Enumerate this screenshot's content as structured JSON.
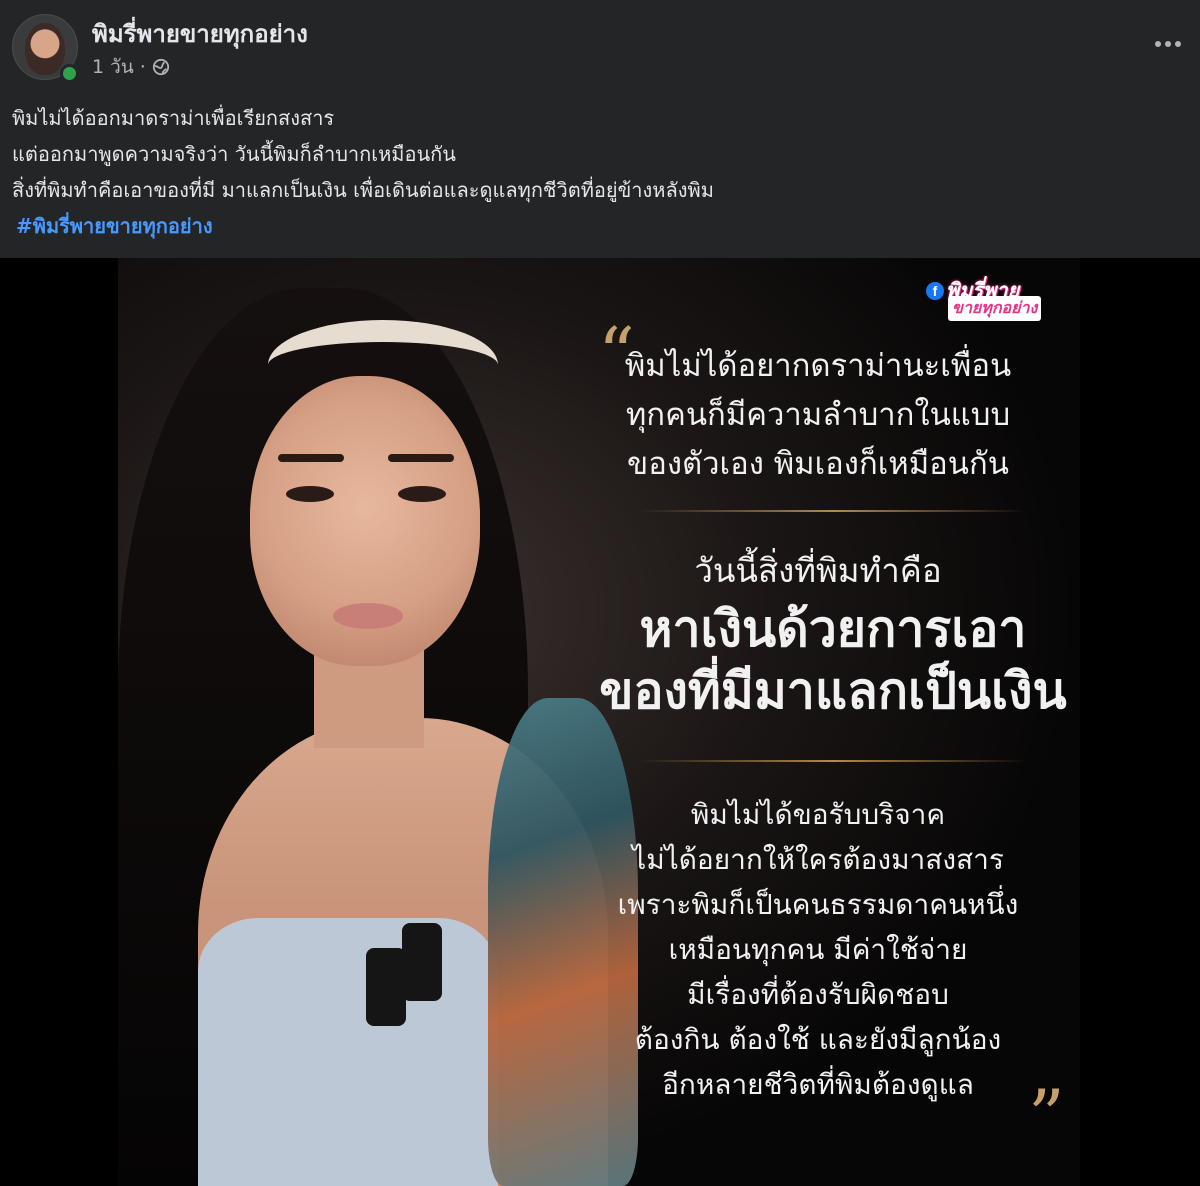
{
  "post": {
    "page_name": "พิมรี่พายขายทุกอย่าง",
    "time": "1 วัน",
    "separator": "·",
    "visibility_icon": "globe-icon",
    "more_icon": "more-options-icon",
    "lines": [
      "พิมไม่ได้ออกมาดราม่าเพื่อเรียกสงสาร",
      "แต่ออกมาพูดความจริงว่า วันนี้พิมก็ลำบากเหมือนกัน",
      "สิ่งที่พิมทำคือเอาของที่มี มาแลกเป็นเงิน เพื่อเดินต่อและดูแลทุกชีวิตที่อยู่ข้างหลังพิม"
    ],
    "hashtag": "#พิมรี่พายขายทุกอย่าง"
  },
  "poster": {
    "logo_line1": "พิมรี่พาย",
    "logo_line2": "ขายทุกอย่าง",
    "quote_open": "“",
    "quote_close": "”",
    "quote_lines": [
      "พิมไม่ได้อยากดราม่านะเพื่อน",
      "ทุกคนก็มีความลำบากในแบบ",
      "ของตัวเอง พิมเองก็เหมือนกัน"
    ],
    "headline_small": "วันนี้สิ่งที่พิมทำคือ",
    "headline_big": [
      "หาเงินด้วยการเอา",
      "ของที่มีมาแลกเป็นเงิน"
    ],
    "body_lines": [
      "พิมไม่ได้ขอรับบริจาค",
      "ไม่ได้อยากให้ใครต้องมาสงสาร",
      "เพราะพิมก็เป็นคนธรรมดาคนหนึ่ง",
      "เหมือนทุกคน มีค่าใช้จ่าย",
      "มีเรื่องที่ต้องรับผิดชอบ",
      "ต้องกิน ต้องใช้ และยังมีลูกน้อง",
      "อีกหลายชีวิตที่พิมต้องดูแล"
    ]
  },
  "colors": {
    "background": "#242526",
    "link": "#4599ff",
    "online": "#31a24c",
    "gold": "#c4a06a",
    "brand_pink": "#e4348a"
  }
}
